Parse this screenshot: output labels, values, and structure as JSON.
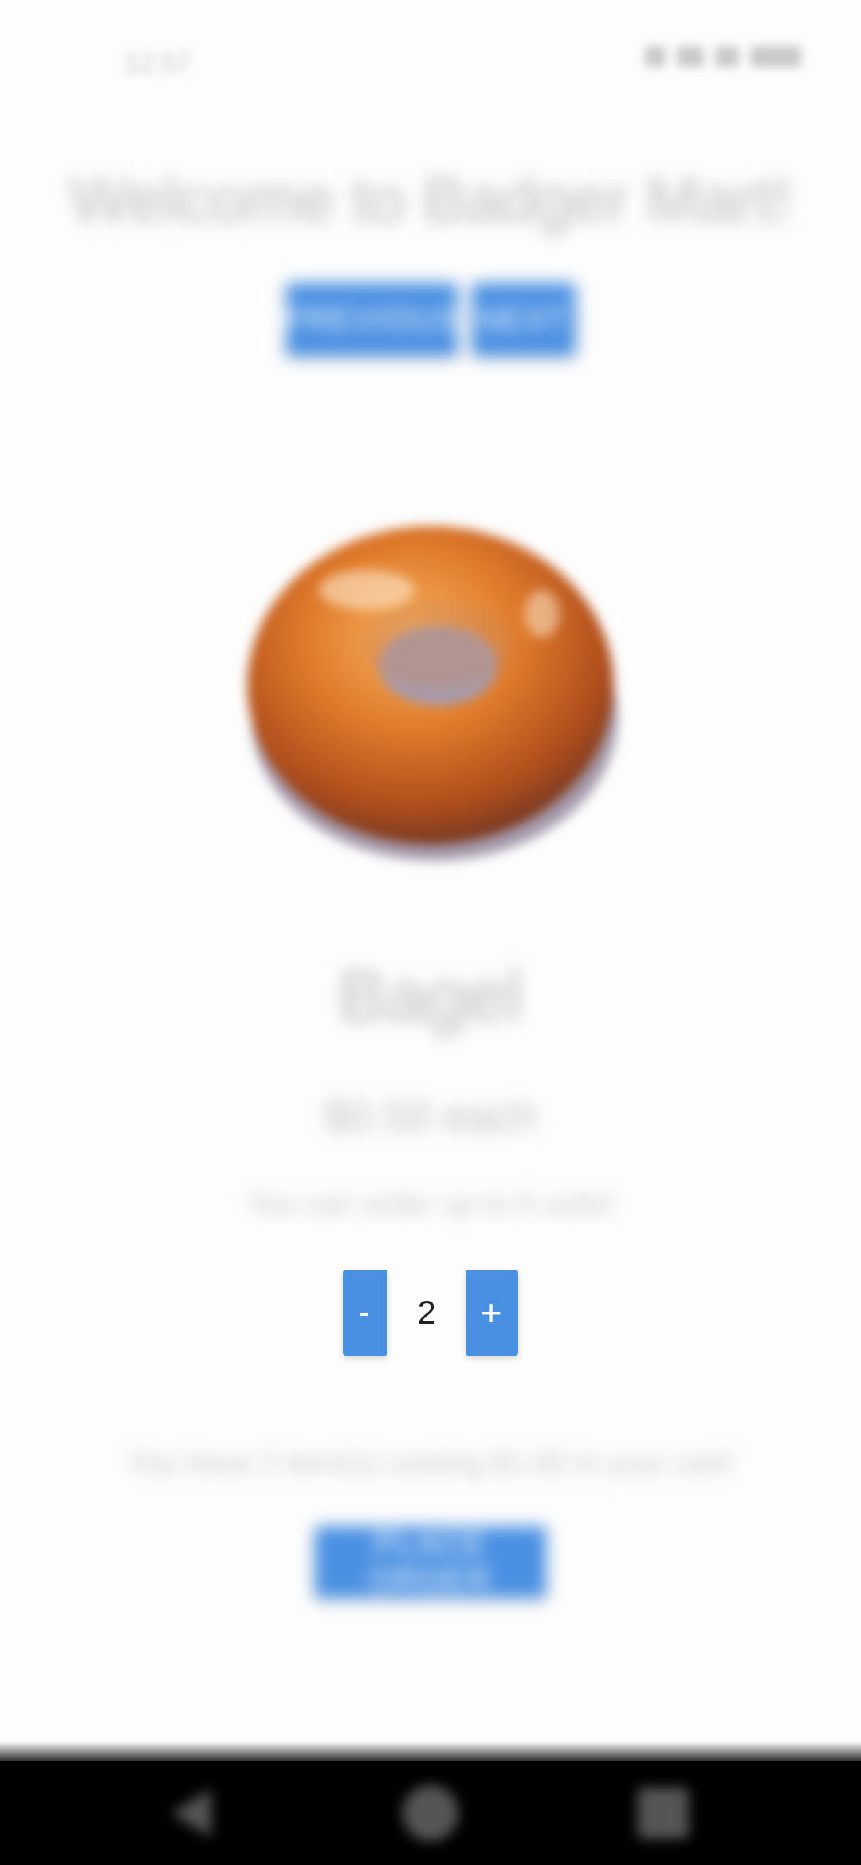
{
  "status_bar": {
    "time": "12:57"
  },
  "header": {
    "title": "Welcome to Badger Mart!"
  },
  "nav": {
    "previous_label": "PREVIOUS",
    "next_label": "NEXT"
  },
  "product": {
    "name": "Bagel",
    "price": "$0.50 each",
    "limit": "You can order up to 6 units!",
    "image_icon": "bagel-image"
  },
  "quantity": {
    "minus_label": "-",
    "value": "2",
    "plus_label": "+"
  },
  "cart": {
    "summary": "You have 2 item(s) costing $1.00 in your cart!",
    "place_order_label": "PLACE ORDER"
  },
  "colors": {
    "accent": "#4a90e2",
    "background": "#fdfdfd"
  }
}
